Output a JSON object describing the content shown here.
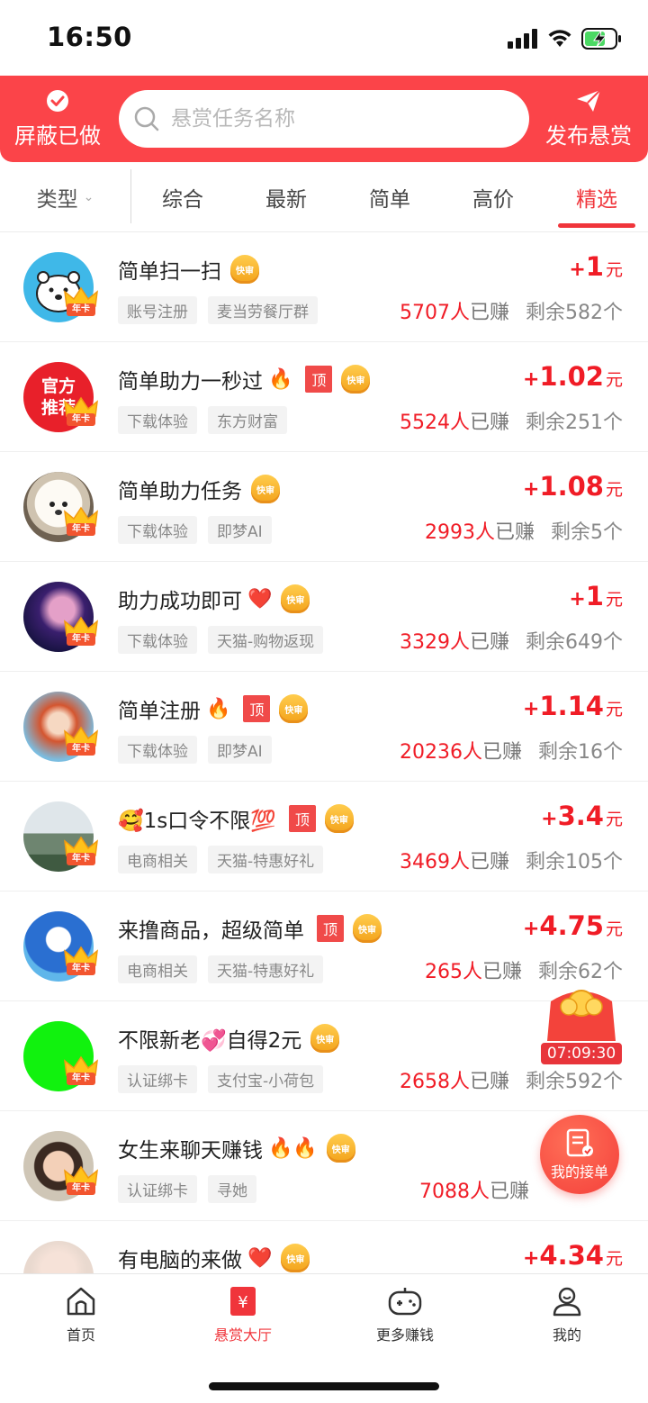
{
  "status_bar": {
    "time": "16:50"
  },
  "header": {
    "left_button_label": "屏蔽已做",
    "search_placeholder": "悬赏任务名称",
    "right_button_label": "发布悬赏",
    "accent_color": "#fb4449"
  },
  "filters": {
    "type_label": "类型",
    "tabs": [
      {
        "label": "综合",
        "active": false
      },
      {
        "label": "最新",
        "active": false
      },
      {
        "label": "简单",
        "active": false
      },
      {
        "label": "高价",
        "active": false
      },
      {
        "label": "精选",
        "active": true
      }
    ]
  },
  "badges": {
    "vip": "年卡",
    "fast": "快审",
    "top": "顶"
  },
  "tasks": [
    {
      "title": "简单扫一扫",
      "emoji": "",
      "top": false,
      "tags": [
        "账号注册",
        "麦当劳餐厅群"
      ],
      "price": "1",
      "unit": "元",
      "earned_count": "5707人",
      "earned_suffix": "已赚",
      "remaining": "剩余582个",
      "avatar": "polar-bear"
    },
    {
      "title": "简单助力一秒过",
      "emoji": "🔥",
      "top": true,
      "tags": [
        "下载体验",
        "东方财富"
      ],
      "price": "1.02",
      "unit": "元",
      "earned_count": "5524人",
      "earned_suffix": "已赚",
      "remaining": "剩余251个",
      "avatar": "official-recommend",
      "avatar_text": "官方推荐"
    },
    {
      "title": "简单助力任务",
      "emoji": "",
      "top": false,
      "tags": [
        "下载体验",
        "即梦AI"
      ],
      "price": "1.08",
      "unit": "元",
      "earned_count": "2993人",
      "earned_suffix": "已赚",
      "remaining": "剩余5个",
      "avatar": "puppy"
    },
    {
      "title": "助力成功即可",
      "emoji": "❤️",
      "top": false,
      "tags": [
        "下载体验",
        "天猫-购物返现"
      ],
      "price": "1",
      "unit": "元",
      "earned_count": "3329人",
      "earned_suffix": "已赚",
      "remaining": "剩余649个",
      "avatar": "girl-purple"
    },
    {
      "title": "简单注册",
      "emoji": "🔥",
      "top": true,
      "tags": [
        "下载体验",
        "即梦AI"
      ],
      "price": "1.14",
      "unit": "元",
      "earned_count": "20236人",
      "earned_suffix": "已赚",
      "remaining": "剩余16个",
      "avatar": "anime-girl"
    },
    {
      "title": "🥰1s口令不限💯",
      "emoji": "",
      "top": true,
      "tags": [
        "电商相关",
        "天猫-特惠好礼"
      ],
      "price": "3.4",
      "unit": "元",
      "earned_count": "3469人",
      "earned_suffix": "已赚",
      "remaining": "剩余105个",
      "avatar": "landscape"
    },
    {
      "title": "来撸商品，超级简单",
      "emoji": "",
      "top": true,
      "tags": [
        "电商相关",
        "天猫-特惠好礼"
      ],
      "price": "4.75",
      "unit": "元",
      "earned_count": "265人",
      "earned_suffix": "已赚",
      "remaining": "剩余62个",
      "avatar": "donald-duck"
    },
    {
      "title": "不限新老💞自得2元",
      "emoji": "",
      "top": false,
      "tags": [
        "认证绑卡",
        "支付宝-小荷包"
      ],
      "price": "",
      "unit": "",
      "earned_count": "2658人",
      "earned_suffix": "已赚",
      "remaining": "剩余592个",
      "avatar": "green"
    },
    {
      "title": "女生来聊天赚钱",
      "emoji": "🔥🔥",
      "top": false,
      "tags": [
        "认证绑卡",
        "寻她"
      ],
      "price": "",
      "unit": "",
      "earned_count": "7088人",
      "earned_suffix": "已赚",
      "remaining": "",
      "avatar": "woman"
    },
    {
      "title": "有电脑的来做",
      "emoji": "❤️",
      "top": false,
      "tags": [],
      "price": "4.34",
      "unit": "元",
      "earned_count": "",
      "earned_suffix": "",
      "remaining": "",
      "avatar": "partial"
    }
  ],
  "floating": {
    "timer": "07:09:30",
    "my_orders_label": "我的接单"
  },
  "bottom_nav": [
    {
      "label": "首页",
      "icon": "home-icon",
      "active": false
    },
    {
      "label": "悬赏大厅",
      "icon": "bounty-hall-icon",
      "active": true
    },
    {
      "label": "更多赚钱",
      "icon": "gamepad-icon",
      "active": false
    },
    {
      "label": "我的",
      "icon": "profile-icon",
      "active": false
    }
  ]
}
